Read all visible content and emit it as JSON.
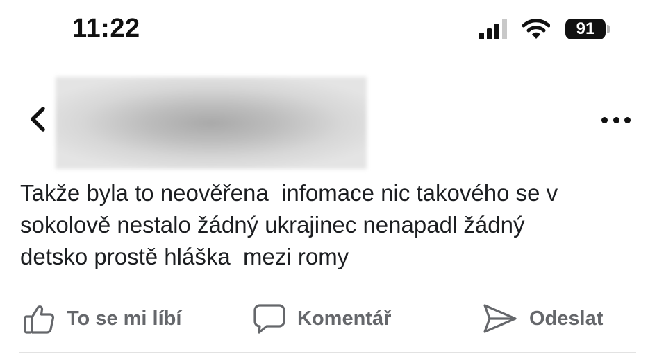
{
  "status_bar": {
    "time": "11:22",
    "battery_level": "91",
    "icons": [
      "cellular-signal-icon",
      "wifi-icon",
      "battery-icon"
    ]
  },
  "header": {
    "back_icon": "chevron-left-icon",
    "more_icon": "more-horizontal-icon"
  },
  "post": {
    "text": "Takže byla to neověřena  infomace nic takového se v\nsokolově nestalo žádný ukrajinec nenapadl žádný\ndetsko prostě hláška  mezi romy"
  },
  "actions": {
    "like": {
      "label": "To se mi líbí",
      "icon": "thumbs-up-icon"
    },
    "comment": {
      "label": "Komentář",
      "icon": "speech-bubble-icon"
    },
    "share": {
      "label": "Odeslat",
      "icon": "send-icon"
    }
  },
  "colors": {
    "text": "#1c1e21",
    "action_gray": "#65676b",
    "divider": "#e2e2e2"
  }
}
